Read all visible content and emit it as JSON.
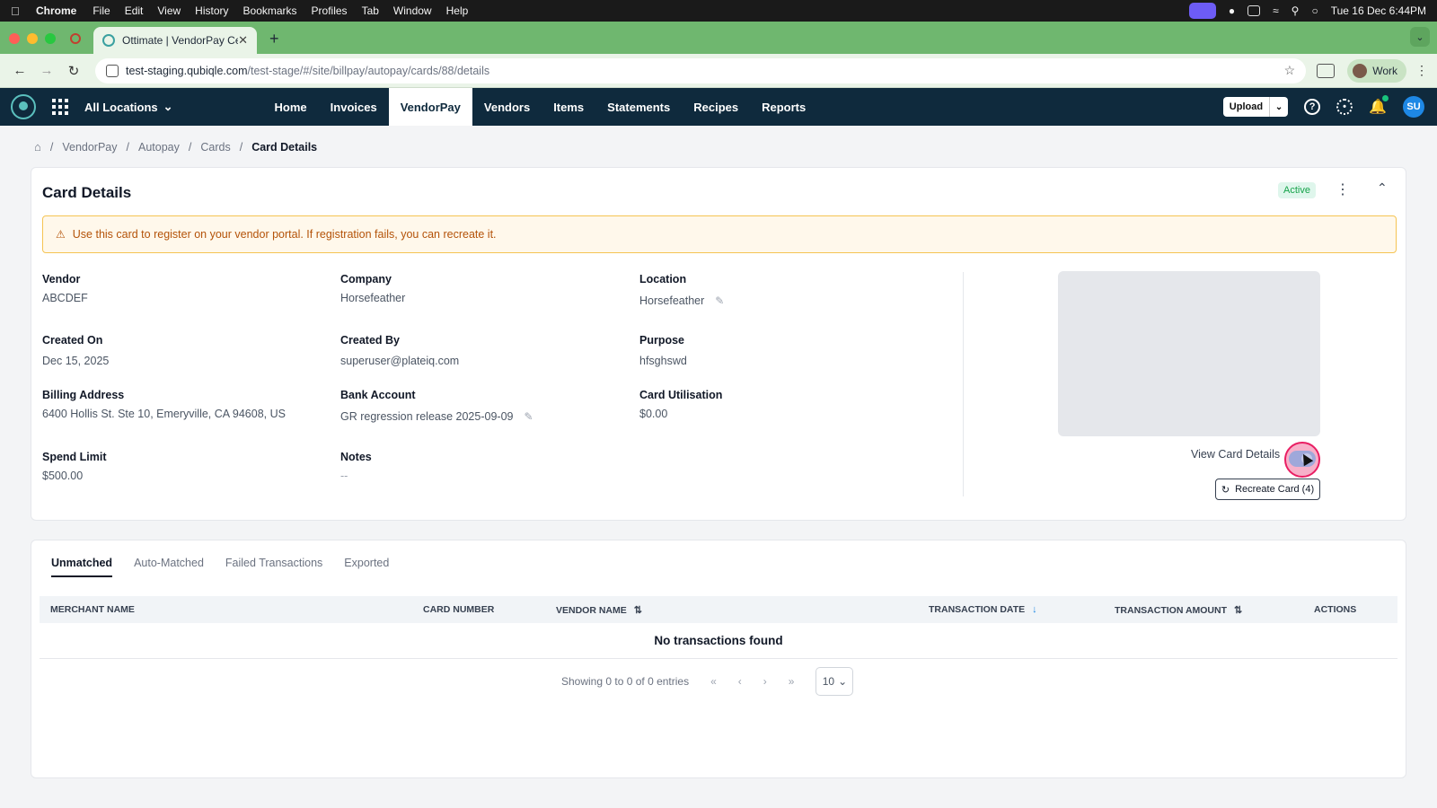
{
  "os_menu": {
    "app": "Chrome",
    "items": [
      "File",
      "Edit",
      "View",
      "History",
      "Bookmarks",
      "Profiles",
      "Tab",
      "Window",
      "Help"
    ],
    "clock": "Tue 16 Dec  6:44PM"
  },
  "browser": {
    "tab_title": "Ottimate | VendorPay Center",
    "url_host": "test-staging.qubiqle.com",
    "url_path": "/test-stage/#/site/billpay/autopay/cards/88/details",
    "profile": "Work"
  },
  "app_nav": {
    "location_selector": "All Locations",
    "links": [
      {
        "label": "Home",
        "active": false
      },
      {
        "label": "Invoices",
        "active": false
      },
      {
        "label": "VendorPay",
        "active": true
      },
      {
        "label": "Vendors",
        "active": false
      },
      {
        "label": "Items",
        "active": false
      },
      {
        "label": "Statements",
        "active": false
      },
      {
        "label": "Recipes",
        "active": false
      },
      {
        "label": "Reports",
        "active": false
      }
    ],
    "upload_label": "Upload",
    "avatar_initials": "SU"
  },
  "breadcrumb": [
    "VendorPay",
    "Autopay",
    "Cards",
    "Card Details"
  ],
  "card": {
    "title": "Card Details",
    "status": "Active",
    "alert": "Use this card to register on your vendor portal. If registration fails, you can recreate it.",
    "fields": {
      "vendor": {
        "label": "Vendor",
        "value": "ABCDEF"
      },
      "company": {
        "label": "Company",
        "value": "Horsefeather"
      },
      "location": {
        "label": "Location",
        "value": "Horsefeather"
      },
      "created_on": {
        "label": "Created On",
        "value": "Dec 15, 2025"
      },
      "created_by": {
        "label": "Created By",
        "value": "superuser@plateiq.com"
      },
      "purpose": {
        "label": "Purpose",
        "value": "hfsghswd"
      },
      "billing_address": {
        "label": "Billing Address",
        "value": "6400 Hollis St. Ste 10, Emeryville, CA 94608, US"
      },
      "bank_account": {
        "label": "Bank Account",
        "value": "GR regression release 2025-09-09"
      },
      "card_utilisation": {
        "label": "Card Utilisation",
        "value": "$0.00"
      },
      "spend_limit": {
        "label": "Spend Limit",
        "value": "$500.00"
      },
      "notes": {
        "label": "Notes",
        "value": "--"
      }
    },
    "view_card_details_label": "View Card Details",
    "recreate_label": "Recreate Card (4)"
  },
  "transactions": {
    "tabs": [
      {
        "label": "Unmatched",
        "active": true
      },
      {
        "label": "Auto-Matched",
        "active": false
      },
      {
        "label": "Failed Transactions",
        "active": false
      },
      {
        "label": "Exported",
        "active": false
      }
    ],
    "columns": [
      "MERCHANT NAME",
      "CARD NUMBER",
      "VENDOR NAME",
      "TRANSACTION DATE",
      "TRANSACTION AMOUNT",
      "ACTIONS"
    ],
    "empty_message": "No transactions found",
    "pagination_text": "Showing 0 to 0 of 0 entries",
    "page_size": "10"
  }
}
